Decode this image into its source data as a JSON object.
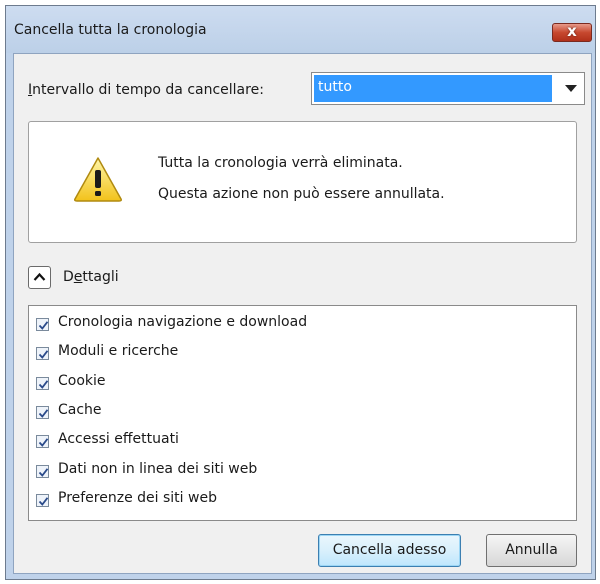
{
  "window": {
    "title": "Cancella tutta la cronologia",
    "close_label": "x"
  },
  "range": {
    "label_first": "I",
    "label_rest": "ntervallo di tempo da cancellare:",
    "selected": "tutto"
  },
  "warning": {
    "line1": "Tutta la cronologia verrà eliminata.",
    "line2": "Questa azione non può essere annullata."
  },
  "details": {
    "label_first": "D",
    "label_second": "e",
    "label_rest": "ttagli",
    "expanded": true
  },
  "items": [
    {
      "label": "Cronologia navigazione e download",
      "checked": true
    },
    {
      "label": "Moduli e ricerche",
      "checked": true
    },
    {
      "label": "Cookie",
      "checked": true
    },
    {
      "label": "Cache",
      "checked": true
    },
    {
      "label": "Accessi effettuati",
      "checked": true
    },
    {
      "label": "Dati non in linea dei siti web",
      "checked": true
    },
    {
      "label": "Preferenze dei siti web",
      "checked": true
    }
  ],
  "buttons": {
    "clear_now": "Cancella adesso",
    "cancel": "Annulla"
  },
  "colors": {
    "selection": "#3399ff",
    "frame": "#bfd2ea",
    "close_button": "#c7482f"
  }
}
